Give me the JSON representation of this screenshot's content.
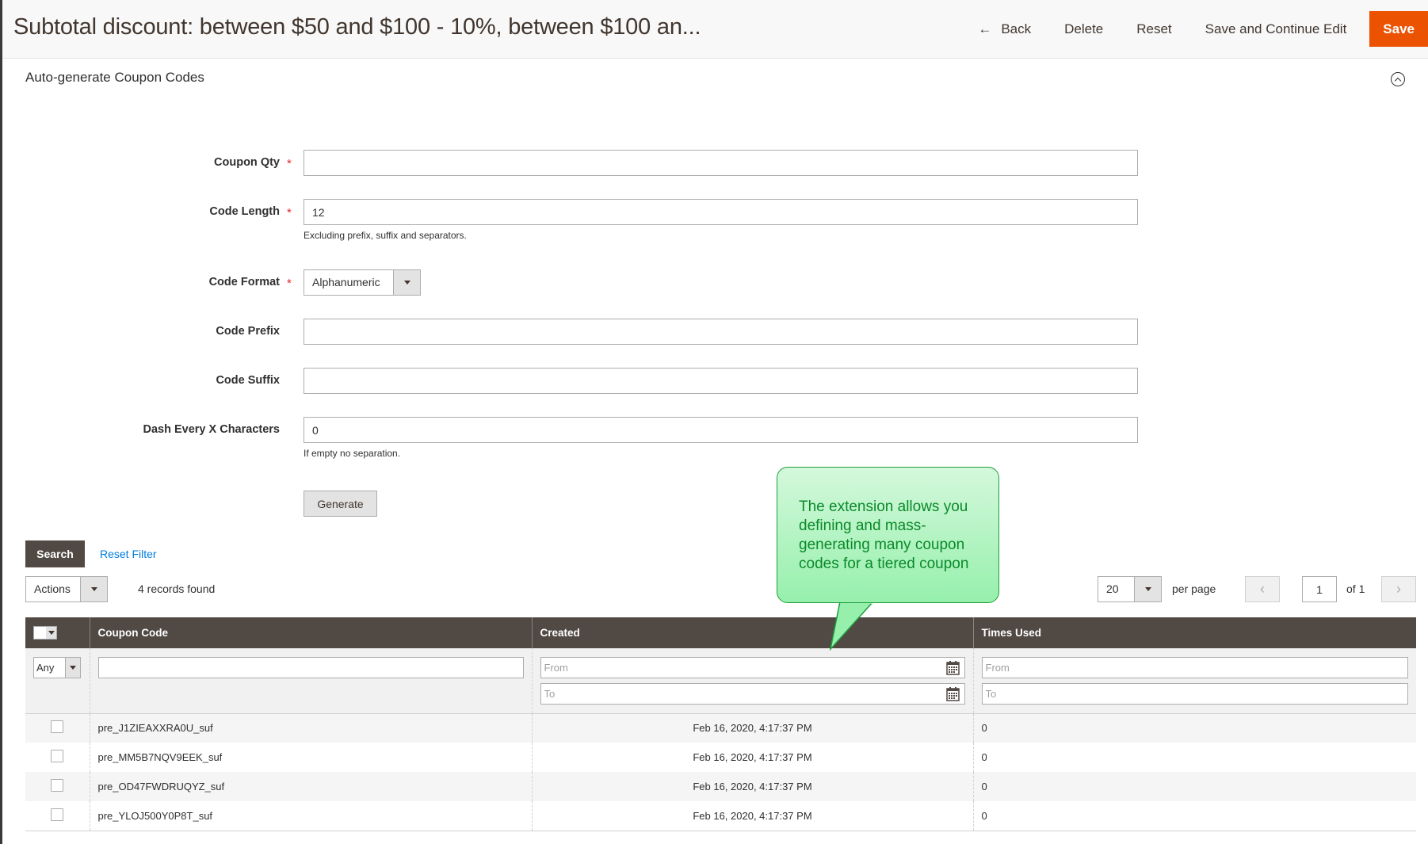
{
  "header": {
    "title": "Subtotal discount: between $50 and $100 - 10%, between $100 an...",
    "actions": {
      "back": "Back",
      "delete": "Delete",
      "reset": "Reset",
      "save_continue": "Save and Continue Edit",
      "save": "Save"
    }
  },
  "section": {
    "title": "Auto-generate Coupon Codes"
  },
  "form": {
    "coupon_qty": {
      "label": "Coupon Qty",
      "value": "",
      "required": true
    },
    "code_length": {
      "label": "Code Length",
      "value": "12",
      "required": true,
      "note": "Excluding prefix, suffix and separators."
    },
    "code_format": {
      "label": "Code Format",
      "value": "Alphanumeric",
      "required": true
    },
    "code_prefix": {
      "label": "Code Prefix",
      "value": ""
    },
    "code_suffix": {
      "label": "Code Suffix",
      "value": ""
    },
    "dash_every": {
      "label": "Dash Every X Characters",
      "value": "0",
      "note": "If empty no separation."
    },
    "generate_label": "Generate"
  },
  "grid": {
    "search_label": "Search",
    "reset_filter_label": "Reset Filter",
    "actions_label": "Actions",
    "records_found": "4 records found",
    "per_page_value": "20",
    "per_page_label": "per page",
    "current_page": "1",
    "page_of": "of 1",
    "columns": [
      "Coupon Code",
      "Created",
      "Times Used"
    ],
    "filters": {
      "mass_select": "Any",
      "coupon_code": "",
      "created_from_placeholder": "From",
      "created_to_placeholder": "To",
      "times_used_from_placeholder": "From",
      "times_used_to_placeholder": "To"
    },
    "rows": [
      {
        "code": "pre_J1ZIEAXXRA0U_suf",
        "created": "Feb 16, 2020, 4:17:37 PM",
        "times_used": "0"
      },
      {
        "code": "pre_MM5B7NQV9EEK_suf",
        "created": "Feb 16, 2020, 4:17:37 PM",
        "times_used": "0"
      },
      {
        "code": "pre_OD47FWDRUQYZ_suf",
        "created": "Feb 16, 2020, 4:17:37 PM",
        "times_used": "0"
      },
      {
        "code": "pre_YLOJ500Y0P8T_suf",
        "created": "Feb 16, 2020, 4:17:37 PM",
        "times_used": "0"
      }
    ]
  },
  "callout": {
    "text": "The extension allows you defining and mass-generating many coupon codes for a tiered coupon"
  },
  "colors": {
    "primary_action": "#eb5202",
    "grid_header": "#514943",
    "link": "#007bdb",
    "callout_text": "#0a8a2a"
  }
}
